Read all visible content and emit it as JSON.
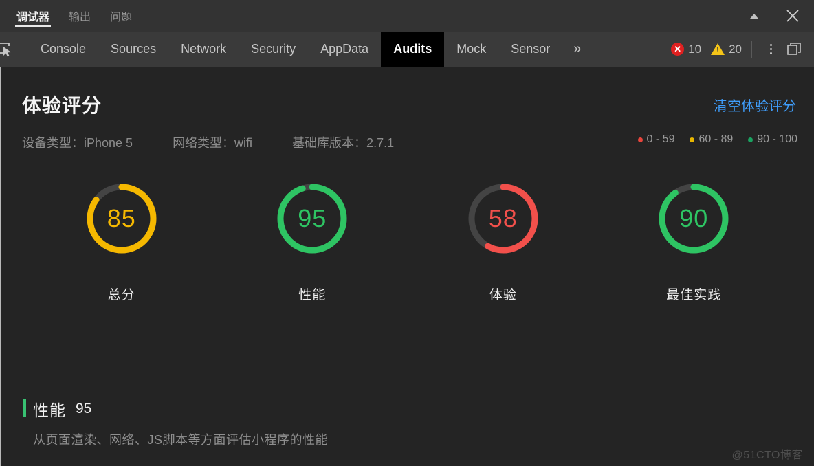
{
  "window": {
    "tabs": [
      {
        "label": "调试器",
        "active": true
      },
      {
        "label": "输出",
        "active": false
      },
      {
        "label": "问题",
        "active": false
      }
    ],
    "controls": {
      "minimize_icon": "caret-up-icon",
      "close_icon": "close-icon"
    }
  },
  "devtools": {
    "inspect_icon": "inspect-element-icon",
    "tabs": [
      {
        "label": "Console",
        "active": false
      },
      {
        "label": "Sources",
        "active": false
      },
      {
        "label": "Network",
        "active": false
      },
      {
        "label": "Security",
        "active": false
      },
      {
        "label": "AppData",
        "active": false
      },
      {
        "label": "Audits",
        "active": true
      },
      {
        "label": "Mock",
        "active": false
      },
      {
        "label": "Sensor",
        "active": false
      }
    ],
    "more_label": "»",
    "errors": {
      "icon": "error-circle-icon",
      "glyph": "✕",
      "count": "10",
      "color": "#e02020"
    },
    "warnings": {
      "icon": "warning-triangle-icon",
      "glyph": "!",
      "count": "20",
      "color": "#f5c518"
    },
    "kebab_icon": "more-options-icon",
    "dock_icon": "dock-panel-icon"
  },
  "audits": {
    "title": "体验评分",
    "clear_label": "清空体验评分",
    "meta": [
      "设备类型：iPhone 5",
      "网络类型：wifi",
      "基础库版本：2.7.1"
    ],
    "legend": [
      {
        "label": "0 - 59",
        "color": "#e8453c"
      },
      {
        "label": "60 - 89",
        "color": "#e8b600"
      },
      {
        "label": "90 - 100",
        "color": "#1aa260"
      }
    ],
    "detail": {
      "name": "性能",
      "score": "95",
      "description": "从页面渲染、网络、JS脚本等方面评估小程序的性能",
      "accent_color": "#38c172"
    },
    "watermark": "@51CTO博客"
  },
  "chart_data": {
    "type": "gauge",
    "title": "体验评分",
    "ylim": [
      0,
      100
    ],
    "categories": [
      "总分",
      "性能",
      "体验",
      "最佳实践"
    ],
    "values": [
      85,
      95,
      58,
      90
    ],
    "colors": [
      "#f5b800",
      "#2ec463",
      "#f2504b",
      "#2ec463"
    ],
    "track_color": "#444444",
    "legend": [
      "0 - 59",
      "60 - 89",
      "90 - 100"
    ],
    "gauges": [
      {
        "label": "总分",
        "value": 85,
        "color": "#f5b800"
      },
      {
        "label": "性能",
        "value": 95,
        "color": "#2ec463"
      },
      {
        "label": "体验",
        "value": 58,
        "color": "#f2504b"
      },
      {
        "label": "最佳实践",
        "value": 90,
        "color": "#2ec463"
      }
    ]
  }
}
